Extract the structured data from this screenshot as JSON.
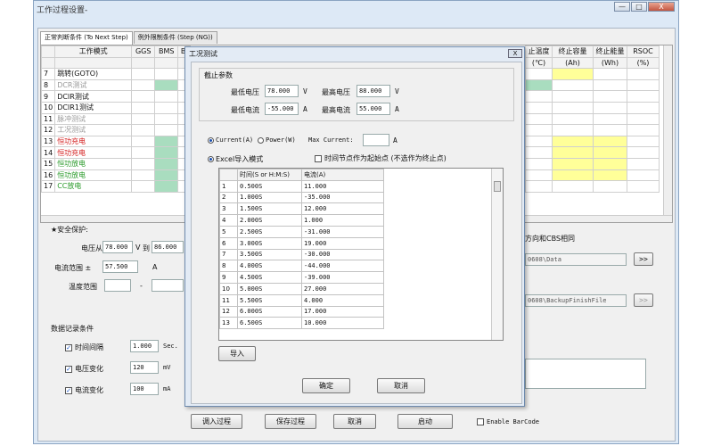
{
  "window": {
    "title": "工作过程设置-",
    "minimize_label": "—",
    "maximize_label": "□",
    "close_label": "X"
  },
  "tabs": [
    "正常判断条件 (To Next Step)",
    "例外限制条件 (Step (NG))"
  ],
  "step_table": {
    "columns": [
      "",
      "工作模式",
      "GGS",
      "BMS",
      "Bl"
    ],
    "right_columns": [
      "止温度",
      "终止容量",
      "终止能量",
      "RSOC"
    ],
    "right_units": [
      "(℃)",
      "(Ah)",
      "(Wh)",
      "(%)"
    ],
    "rows": [
      {
        "no": "7",
        "mode": "跳转(GOTO)",
        "cls": ""
      },
      {
        "no": "8",
        "mode": "DCR测试",
        "cls": "c-gray"
      },
      {
        "no": "9",
        "mode": "DCIR测试",
        "cls": ""
      },
      {
        "no": "10",
        "mode": "DCIR1测试",
        "cls": ""
      },
      {
        "no": "11",
        "mode": "脉冲测试",
        "cls": "c-gray"
      },
      {
        "no": "12",
        "mode": "工况测试",
        "cls": "c-gray"
      },
      {
        "no": "13",
        "mode": "恒功充电",
        "cls": "c-red"
      },
      {
        "no": "14",
        "mode": "恒功充电",
        "cls": "c-red"
      },
      {
        "no": "15",
        "mode": "恒功放电",
        "cls": "c-green"
      },
      {
        "no": "16",
        "mode": "恒功放电",
        "cls": "c-green"
      },
      {
        "no": "17",
        "mode": "CC放电",
        "cls": "c-green"
      }
    ]
  },
  "safety": {
    "heading": "★安全保护:",
    "voltage_label": "电压从",
    "voltage_from": "78.000",
    "unit_v": "V",
    "to_label": "到",
    "voltage_to": "86.000",
    "current_label": "电流范围 ±",
    "current_value": "57.500",
    "unit_a": "A",
    "temp_label": "温度范围",
    "temp_from": "",
    "temp_dash": "-",
    "temp_to": ""
  },
  "record": {
    "heading": "数据记录条件",
    "items": [
      {
        "label": "时间间隔",
        "value": "1.000",
        "unit": "Sec."
      },
      {
        "label": "电压变化",
        "value": "120",
        "unit": "mV"
      },
      {
        "label": "电流变化",
        "value": "100",
        "unit": "mA"
      }
    ]
  },
  "right_panel": {
    "direction_text": "方向和CBS相同",
    "path1": "0608\\Data",
    "path2": "0608\\BackupFinishFile",
    "browse_label": ">>"
  },
  "bottom_buttons": {
    "load": "调入过程",
    "save": "保存过程",
    "cancel": "取消",
    "start": "启动",
    "barcode": "Enable BarCode"
  },
  "dialog": {
    "title": "工况测试",
    "close": "X",
    "cutoff_heading": "截止参数",
    "min_v_label": "最低电压",
    "min_v": "78.000",
    "max_v_label": "最高电压",
    "max_v": "88.000",
    "min_i_label": "最低电流",
    "min_i": "-55.000",
    "max_i_label": "最高电流",
    "max_i": "55.000",
    "unit_v": "V",
    "unit_a": "A",
    "radio_current": "Current(A)",
    "radio_power": "Power(W)",
    "max_current_label": "Max Current:",
    "max_current_value": "",
    "excel_label": "Excel导入模式",
    "timepoint_label": "时间节点作为起始点 (不选作为终止点)",
    "table_headers": [
      "",
      "时间(S or H:M:S)",
      "电流(A)"
    ],
    "table_rows": [
      [
        "1",
        "0.500S",
        "11.000"
      ],
      [
        "2",
        "1.000S",
        "-35.000"
      ],
      [
        "3",
        "1.500S",
        "12.000"
      ],
      [
        "4",
        "2.000S",
        "1.000"
      ],
      [
        "5",
        "2.500S",
        "-31.000"
      ],
      [
        "6",
        "3.000S",
        "19.000"
      ],
      [
        "7",
        "3.500S",
        "-30.000"
      ],
      [
        "8",
        "4.000S",
        "-44.000"
      ],
      [
        "9",
        "4.500S",
        "-39.000"
      ],
      [
        "10",
        "5.000S",
        "27.000"
      ],
      [
        "11",
        "5.500S",
        "4.000"
      ],
      [
        "12",
        "6.000S",
        "17.000"
      ],
      [
        "13",
        "6.500S",
        "10.000"
      ]
    ],
    "import_label": "导入",
    "ok_label": "确定",
    "cancel_label": "取消"
  }
}
